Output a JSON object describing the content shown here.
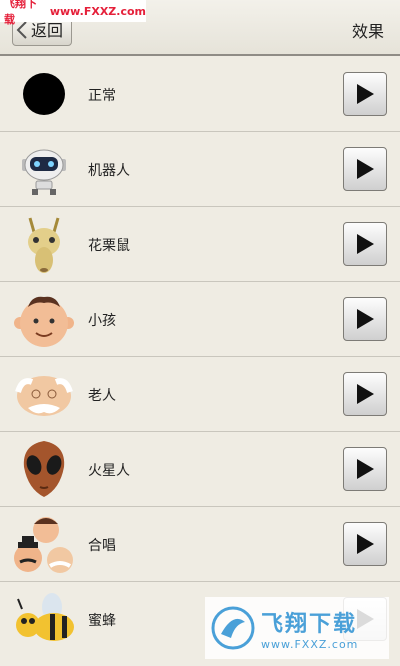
{
  "watermark_top": {
    "part1": "飞翔下载",
    "part2": "www.FXXZ.com"
  },
  "header": {
    "back_label": "返回",
    "title": "效果"
  },
  "items": [
    {
      "label": "正常",
      "icon": "black-circle-icon"
    },
    {
      "label": "机器人",
      "icon": "robot-icon"
    },
    {
      "label": "花栗鼠",
      "icon": "chipmunk-icon"
    },
    {
      "label": "小孩",
      "icon": "child-icon"
    },
    {
      "label": "老人",
      "icon": "old-man-icon"
    },
    {
      "label": "火星人",
      "icon": "alien-icon"
    },
    {
      "label": "合唱",
      "icon": "chorus-icon"
    },
    {
      "label": "蜜蜂",
      "icon": "bee-icon"
    }
  ],
  "watermark_bottom": {
    "big": "飞翔下载",
    "small": "www.FXXZ.com"
  },
  "colors": {
    "background": "#efece3",
    "divider": "#c9c6bd",
    "accent": "#e5203a"
  }
}
